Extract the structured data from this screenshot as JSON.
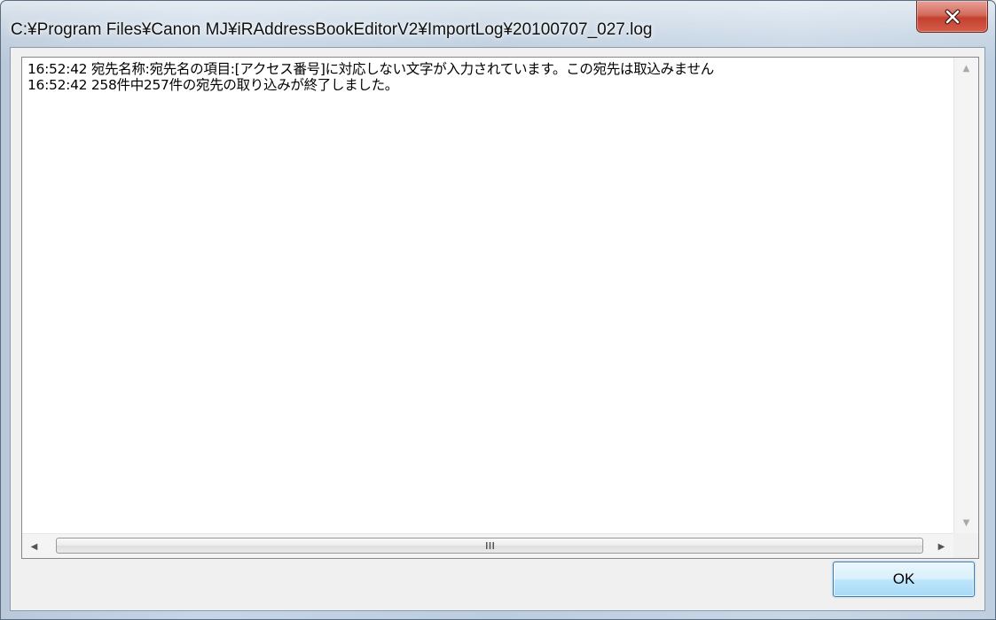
{
  "window": {
    "title": "C:¥Program Files¥Canon MJ¥iRAddressBookEditorV2¥ImportLog¥20100707_027.log"
  },
  "log": {
    "lines": [
      "16:52:42 宛先名称:宛先名の項目:[アクセス番号]に対応しない文字が入力されています。この宛先は取込みません",
      "16:52:42 258件中257件の宛先の取り込みが終了しました。"
    ]
  },
  "buttons": {
    "ok_label": "OK"
  },
  "icons": {
    "close": "close-icon",
    "scroll_up": "scroll-up-arrow-icon",
    "scroll_down": "scroll-down-arrow-icon",
    "scroll_left": "scroll-left-arrow-icon",
    "scroll_right": "scroll-right-arrow-icon",
    "grip": "scroll-grip-icon"
  },
  "colors": {
    "close_button": "#c4402f",
    "ok_button_border": "#3c7fb1",
    "window_frame": "#c6d6e6"
  }
}
